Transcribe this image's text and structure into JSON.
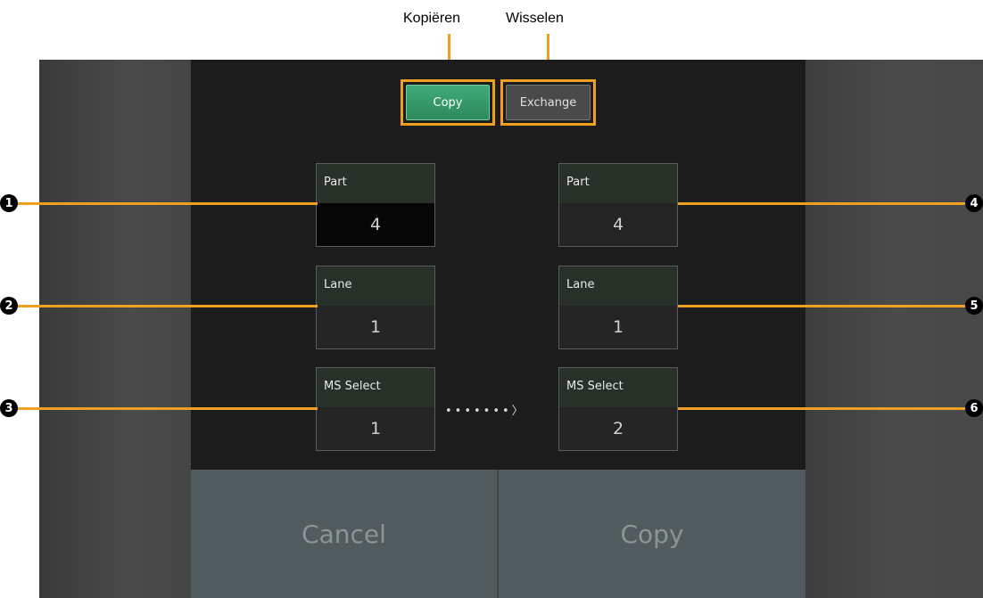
{
  "annotations": {
    "copy_label": "Kopiëren",
    "exchange_label": "Wisselen",
    "markers": [
      "1",
      "2",
      "3",
      "4",
      "5",
      "6"
    ],
    "accent_color": "#f0a020"
  },
  "mode_buttons": {
    "copy": "Copy",
    "exchange": "Exchange",
    "selected": "Copy"
  },
  "source": [
    {
      "label": "Part",
      "value": "4"
    },
    {
      "label": "Lane",
      "value": "1"
    },
    {
      "label": "MS Select",
      "value": "1"
    }
  ],
  "destination": [
    {
      "label": "Part",
      "value": "4"
    },
    {
      "label": "Lane",
      "value": "1"
    },
    {
      "label": "MS Select",
      "value": "2"
    }
  ],
  "arrow": "•••••••〉",
  "actions": {
    "cancel": "Cancel",
    "copy": "Copy"
  },
  "colors": {
    "copy_active": "#2c8a5c",
    "screen_bg": "#1c1c1c",
    "bottom_button": "#525b5d"
  }
}
